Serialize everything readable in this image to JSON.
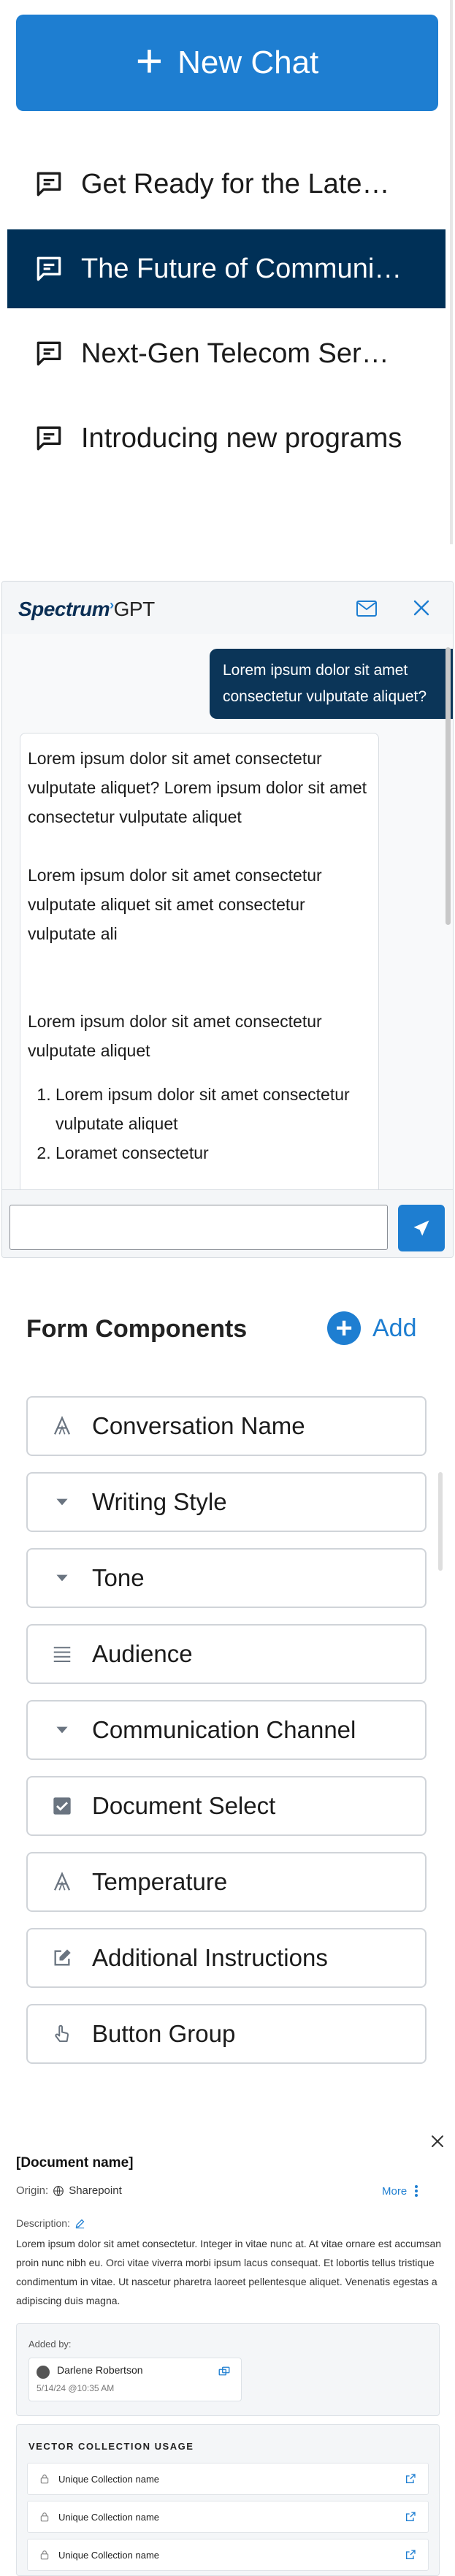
{
  "chat_sidebar": {
    "new_chat_label": "New Chat",
    "items": [
      {
        "label": "Get Ready for the Latest Features"
      },
      {
        "label": "The Future of Communication"
      },
      {
        "label": "Next-Gen Telecom Services"
      },
      {
        "label": "Introducing new programs"
      }
    ],
    "active_index": 1,
    "icon": "chat-bubble-icon"
  },
  "gpt_widget": {
    "brand": "Spectrum",
    "brand_suffix": "GPT",
    "user_message": "Lorem ipsum dolor sit amet consectetur vulputate aliquet?",
    "bot_paragraphs": [
      "Lorem ipsum dolor sit amet consectetur vulputate aliquet? Lorem ipsum dolor sit amet consectetur vulputate aliquet",
      "Lorem ipsum dolor sit amet consectetur vulputate aliquet sit amet consectetur vulputate ali",
      "Lorem ipsum dolor sit amet consectetur vulputate aliquet"
    ],
    "bot_list": [
      "Lorem ipsum dolor sit amet consectetur vulputate aliquet",
      "Loramet consectetur"
    ],
    "input_value": ""
  },
  "form_components": {
    "title": "Form Components",
    "add_label": "Add",
    "items": [
      {
        "label": "Conversation Name",
        "icon": "text-a-icon"
      },
      {
        "label": "Writing Style",
        "icon": "caret-down-icon"
      },
      {
        "label": "Tone",
        "icon": "caret-down-icon"
      },
      {
        "label": "Audience",
        "icon": "paragraph-lines-icon"
      },
      {
        "label": "Communication Channel",
        "icon": "caret-down-icon"
      },
      {
        "label": "Document Select",
        "icon": "checkbox-checked-icon"
      },
      {
        "label": "Temperature",
        "icon": "text-a-icon"
      },
      {
        "label": "Additional Instructions",
        "icon": "edit-square-icon"
      },
      {
        "label": "Button Group",
        "icon": "hand-pointer-icon"
      }
    ]
  },
  "document": {
    "name": "[Document name]",
    "origin_label": "Origin:",
    "origin_value": "Sharepoint",
    "more_label": "More",
    "description_label": "Description:",
    "description": "Lorem ipsum dolor sit amet consectetur. Integer in vitae nunc at. At vitae ornare est accumsan proin nunc nibh eu. Orci vitae viverra morbi ipsum lacus consequat. Et lobortis tellus tristique condimentum in vitae. Ut nascetur pharetra laoreet pellentesque aliquet. Venenatis egestas a adipiscing duis magna.",
    "added_by_label": "Added by:",
    "added_by_name": "Darlene Robertson",
    "added_date": "5/14/24 @10:35 AM",
    "vector_title": "VECTOR COLLECTION USAGE",
    "collections": [
      {
        "name": "Unique Collection name"
      },
      {
        "name": "Unique Collection name"
      },
      {
        "name": "Unique Collection name"
      }
    ]
  },
  "colors": {
    "primary": "#1e7ed1",
    "navy": "#003057",
    "bubble_navy": "#0b3558"
  }
}
